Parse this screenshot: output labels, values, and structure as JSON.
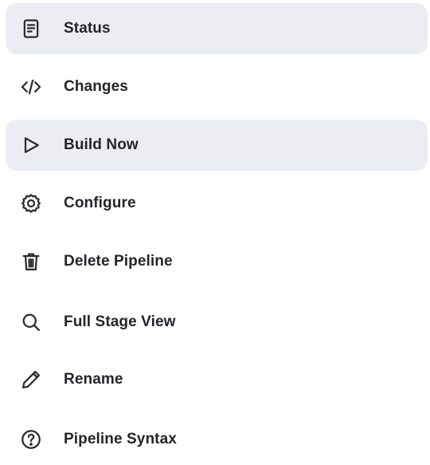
{
  "menu": {
    "items": [
      {
        "label": "Status",
        "icon": "document-icon",
        "highlighted": true
      },
      {
        "label": "Changes",
        "icon": "code-icon",
        "highlighted": false
      },
      {
        "label": "Build Now",
        "icon": "play-icon",
        "highlighted": true
      },
      {
        "label": "Configure",
        "icon": "gear-icon",
        "highlighted": false
      },
      {
        "label": "Delete Pipeline",
        "icon": "trash-icon",
        "highlighted": false
      },
      {
        "label": "Full Stage View",
        "icon": "search-icon",
        "highlighted": false
      },
      {
        "label": "Rename",
        "icon": "pencil-icon",
        "highlighted": false
      },
      {
        "label": "Pipeline Syntax",
        "icon": "help-icon",
        "highlighted": false
      }
    ]
  },
  "colors": {
    "highlight_background": "#ececf3",
    "text": "#24242a",
    "icon_stroke": "#2a2a30"
  }
}
